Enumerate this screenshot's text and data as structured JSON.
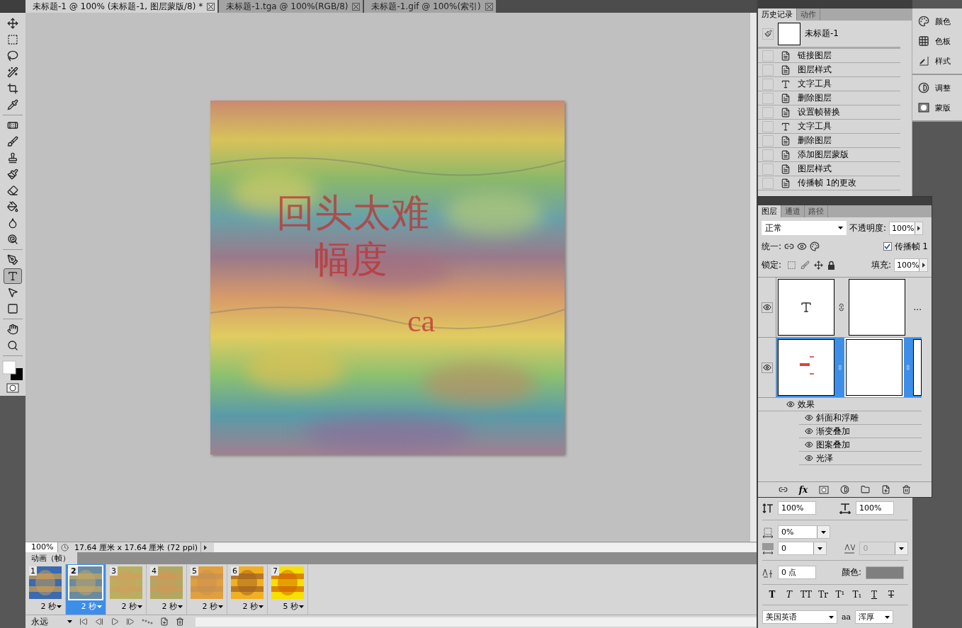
{
  "document_tabs": [
    {
      "label": "未标题-1 @ 100% (未标题-1, 图层蒙版/8) *",
      "selected": true
    },
    {
      "label": "未标题-1.tga @ 100%(RGB/8)",
      "selected": false
    },
    {
      "label": "未标题-1.gif @ 100%(索引)",
      "selected": false
    }
  ],
  "tool_groups": [
    [
      {
        "kind": "move",
        "selected": false
      },
      {
        "kind": "marquee",
        "selected": false
      },
      {
        "kind": "lasso",
        "selected": false
      },
      {
        "kind": "wand",
        "selected": false
      },
      {
        "kind": "crop",
        "selected": false
      },
      {
        "kind": "eyedropper",
        "selected": false
      }
    ],
    [
      {
        "kind": "heal",
        "selected": false
      },
      {
        "kind": "brush",
        "selected": false
      },
      {
        "kind": "stamp",
        "selected": false
      },
      {
        "kind": "history_brush",
        "selected": false
      },
      {
        "kind": "eraser",
        "selected": false
      },
      {
        "kind": "bucket",
        "selected": false
      },
      {
        "kind": "blur",
        "selected": false
      },
      {
        "kind": "dodge",
        "selected": false
      }
    ],
    [
      {
        "kind": "pen",
        "selected": false
      },
      {
        "kind": "type",
        "selected": true
      },
      {
        "kind": "path_select",
        "selected": false
      },
      {
        "kind": "shape",
        "selected": false
      }
    ],
    [
      {
        "kind": "hand",
        "selected": false
      },
      {
        "kind": "zoom",
        "selected": false
      }
    ]
  ],
  "canvas": {
    "kind": "picture",
    "texts": [
      "回头太难",
      "幅度",
      "ca"
    ]
  },
  "status_bar": {
    "zoom": "100%",
    "document_size": "17.64 厘米 x 17.64 厘米 (72 ppi)"
  },
  "animation_panel": {
    "title": "动画（帧）",
    "frames": [
      {
        "number": "1",
        "delay": "2 秒",
        "selected": false
      },
      {
        "number": "2",
        "delay": "2 秒",
        "selected": true
      },
      {
        "number": "3",
        "delay": "2 秒",
        "selected": false
      },
      {
        "number": "4",
        "delay": "2 秒",
        "selected": false
      },
      {
        "number": "5",
        "delay": "2 秒",
        "selected": false
      },
      {
        "number": "6",
        "delay": "2 秒",
        "selected": false
      },
      {
        "number": "7",
        "delay": "5 秒",
        "selected": false
      }
    ],
    "loop": "永远"
  },
  "history_panel": {
    "tabs": [
      {
        "label": "历史记录",
        "selected": true
      },
      {
        "label": "动作",
        "selected": false
      }
    ],
    "snapshot": "未标题-1",
    "steps": [
      {
        "kind": "document",
        "label": "链接图层"
      },
      {
        "kind": "document",
        "label": "图层样式"
      },
      {
        "kind": "type",
        "label": "文字工具"
      },
      {
        "kind": "document",
        "label": "删除图层"
      },
      {
        "kind": "document",
        "label": "设置帧替换"
      },
      {
        "kind": "type",
        "label": "文字工具"
      },
      {
        "kind": "document",
        "label": "删除图层"
      },
      {
        "kind": "document",
        "label": "添加图层蒙版"
      },
      {
        "kind": "document",
        "label": "图层样式"
      },
      {
        "kind": "document",
        "label": "传播帧 1的更改"
      }
    ]
  },
  "dock_groups": [
    [
      {
        "kind": "color",
        "label": "颜色"
      },
      {
        "kind": "swatches",
        "label": "色板"
      },
      {
        "kind": "styles",
        "label": "样式"
      }
    ],
    [
      {
        "kind": "adjustments",
        "label": "调整"
      },
      {
        "kind": "masks",
        "label": "蒙版"
      }
    ]
  ],
  "layers_panel": {
    "tabs": [
      {
        "label": "图层",
        "selected": true
      },
      {
        "label": "通道",
        "selected": false
      },
      {
        "label": "路径",
        "selected": false
      }
    ],
    "blend_mode": "正常",
    "opacity_label": "不透明度:",
    "opacity": "100%",
    "unify_label": "统一:",
    "propagate": {
      "label": "传播帧 1",
      "checked": true
    },
    "lock_label": "锁定:",
    "fill_label": "填充:",
    "fill": "100%",
    "layers": [
      {
        "kind": "text",
        "visible": true,
        "selected": false,
        "more": "..."
      },
      {
        "kind": "masked",
        "visible": true,
        "selected": true,
        "effects_label": "效果",
        "effects": [
          "斜面和浮雕",
          "渐变叠加",
          "图案叠加",
          "光泽"
        ]
      }
    ],
    "footer_fx": "fx"
  },
  "character_panel": {
    "vertical_scale": "100%",
    "horizontal_scale": "100%",
    "tsume": "0%",
    "kerning": "0",
    "tracking": "0",
    "baseline_shift": "0 点",
    "color_label": "颜色:",
    "color": "#7f7f7f",
    "styles": [
      {
        "kind": "bold",
        "label": "T"
      },
      {
        "kind": "italic",
        "label": "T"
      },
      {
        "kind": "caps",
        "label": "TT"
      },
      {
        "kind": "small_caps",
        "label": "Tr"
      },
      {
        "kind": "super",
        "label": "T¹"
      },
      {
        "kind": "sub",
        "label": "T₁"
      },
      {
        "kind": "underline",
        "label": "T"
      },
      {
        "kind": "strike",
        "label": "T"
      }
    ],
    "language": "美国英语",
    "antialias_icon": "aa",
    "antialias": "浑厚"
  }
}
